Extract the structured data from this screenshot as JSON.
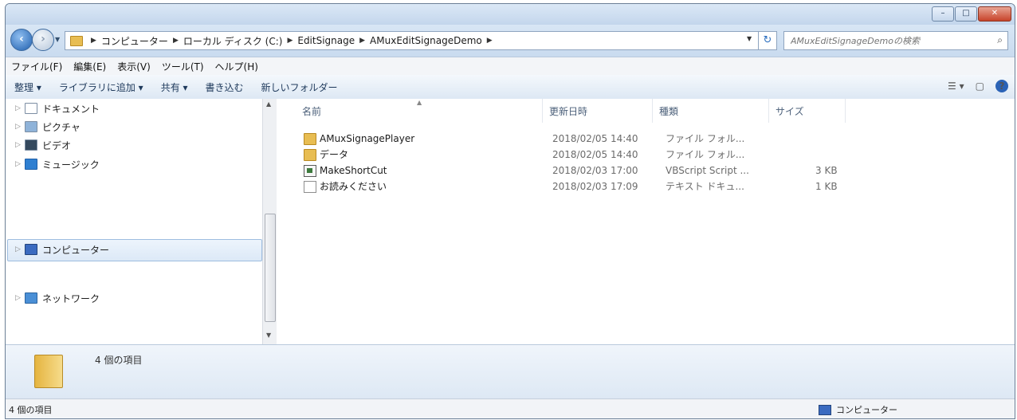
{
  "window": {
    "caption_buttons": [
      "–",
      "□",
      "✕"
    ]
  },
  "address": {
    "breadcrumbs": [
      "コンピューター",
      "ローカル ディスク (C:)",
      "EditSignage",
      "AMuxEditSignageDemo"
    ],
    "search_placeholder": "AMuxEditSignageDemoの検索"
  },
  "menu": [
    "ファイル(F)",
    "編集(E)",
    "表示(V)",
    "ツール(T)",
    "ヘルプ(H)"
  ],
  "commands": [
    "整理 ▾",
    "ライブラリに追加 ▾",
    "共有 ▾",
    "書き込む",
    "新しいフォルダー"
  ],
  "nav": {
    "items": [
      {
        "label": "ドキュメント",
        "icon": "document-icon"
      },
      {
        "label": "ピクチャ",
        "icon": "picture-icon"
      },
      {
        "label": "ビデオ",
        "icon": "video-icon"
      },
      {
        "label": "ミュージック",
        "icon": "music-icon"
      },
      {
        "label": "コンピューター",
        "icon": "computer-icon"
      },
      {
        "label": "ネットワーク",
        "icon": "network-icon"
      }
    ]
  },
  "columns": [
    "名前",
    "更新日時",
    "種類",
    "サイズ"
  ],
  "files": [
    {
      "name": "AMuxSignagePlayer",
      "date": "2018/02/05 14:40",
      "type": "ファイル フォル...",
      "size": "",
      "icon": "folder-icon"
    },
    {
      "name": "データ",
      "date": "2018/02/05 14:40",
      "type": "ファイル フォル...",
      "size": "",
      "icon": "folder-icon"
    },
    {
      "name": "MakeShortCut",
      "date": "2018/02/03 17:00",
      "type": "VBScript Script ...",
      "size": "3 KB",
      "icon": "script-icon"
    },
    {
      "name": "お読みください",
      "date": "2018/02/03 17:09",
      "type": "テキスト ドキュ...",
      "size": "1 KB",
      "icon": "text-file-icon"
    }
  ],
  "details": {
    "item_count": "4 個の項目"
  },
  "status": {
    "left": "4 個の項目",
    "right": "コンピューター"
  },
  "colors": {
    "chrome": "#cfe0f1",
    "selection": "#dce9f7",
    "folder": "#e8bd52"
  }
}
